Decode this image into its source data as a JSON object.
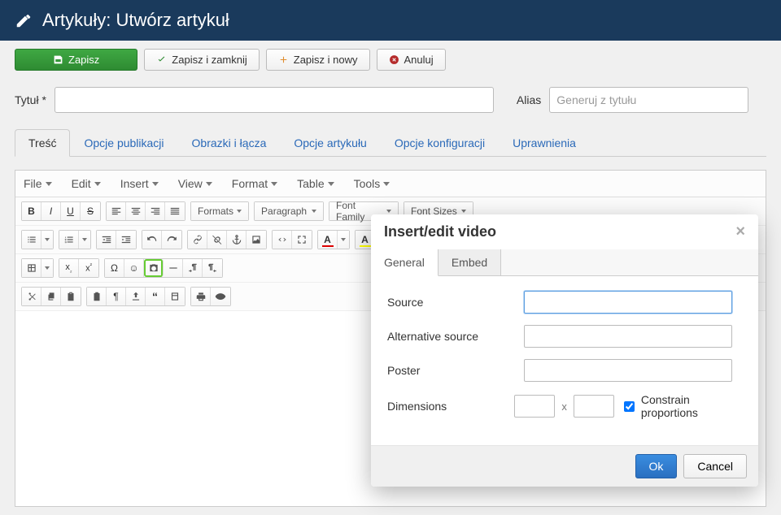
{
  "header": {
    "title": "Artykuły: Utwórz artykuł"
  },
  "actions": {
    "save": "Zapisz",
    "save_close": "Zapisz i zamknij",
    "save_new": "Zapisz i nowy",
    "cancel": "Anuluj"
  },
  "form": {
    "title_label": "Tytuł *",
    "title_value": "",
    "alias_label": "Alias",
    "alias_placeholder": "Generuj z tytułu",
    "alias_value": ""
  },
  "tabs": {
    "content": "Treść",
    "publishing": "Opcje publikacji",
    "images": "Obrazki i łącza",
    "article_opts": "Opcje artykułu",
    "config_opts": "Opcje konfiguracji",
    "permissions": "Uprawnienia"
  },
  "editor_menus": {
    "file": "File",
    "edit": "Edit",
    "insert": "Insert",
    "view": "View",
    "format": "Format",
    "table": "Table",
    "tools": "Tools"
  },
  "editor_dd": {
    "formats": "Formats",
    "paragraph": "Paragraph",
    "font_family": "Font Family",
    "font_sizes": "Font Sizes"
  },
  "modal": {
    "title": "Insert/edit video",
    "tab_general": "General",
    "tab_embed": "Embed",
    "source": "Source",
    "alt_source": "Alternative source",
    "poster": "Poster",
    "dimensions": "Dimensions",
    "dim_sep": "x",
    "constrain": "Constrain proportions",
    "ok": "Ok",
    "cancel": "Cancel",
    "values": {
      "source": "",
      "alt_source": "",
      "poster": "",
      "width": "",
      "height": "",
      "constrain_checked": true
    }
  }
}
